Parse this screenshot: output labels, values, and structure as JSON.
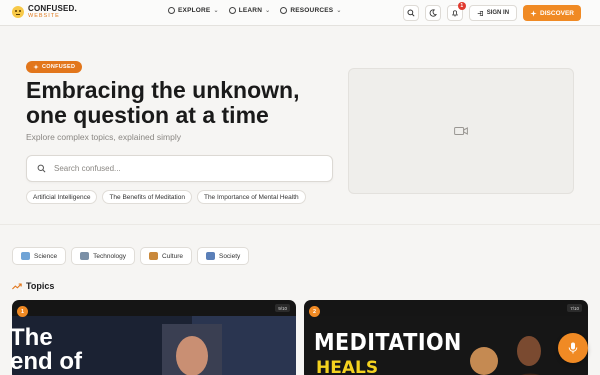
{
  "brand": {
    "name": "CONFUSED.",
    "subtitle": "WEBSITE"
  },
  "nav": {
    "items": [
      {
        "label": "EXPLORE",
        "icon": "compass-icon"
      },
      {
        "label": "LEARN",
        "icon": "compass-icon"
      },
      {
        "label": "RESOURCES",
        "icon": "compass-icon"
      }
    ],
    "notifications_count": "1",
    "signin_label": "SIGN IN",
    "discover_label": "DISCOVER"
  },
  "hero": {
    "tag": "CONFUSED",
    "title": "Embracing the unknown, one question at a time",
    "subtitle": "Explore complex topics, explained simply",
    "search_placeholder": "Search confused...",
    "suggestions": [
      "Artificial Intelligence",
      "The Benefits of Meditation",
      "The Importance of Mental Health"
    ]
  },
  "categories": [
    {
      "label": "Science",
      "icon": "lab-icon",
      "color": "#6fa3d6"
    },
    {
      "label": "Technology",
      "icon": "robot-icon",
      "color": "#7a8fa6"
    },
    {
      "label": "Culture",
      "icon": "palette-icon",
      "color": "#c9883a"
    },
    {
      "label": "Society",
      "icon": "people-icon",
      "color": "#5a7fb8"
    }
  ],
  "topics": {
    "heading": "Topics",
    "cards": [
      {
        "number": "1",
        "count": "9/10",
        "title_lines": [
          "The",
          "end of"
        ]
      },
      {
        "number": "2",
        "count": "7/10",
        "title_line1": "MEDITATION",
        "title_line2": "HEALS"
      }
    ]
  },
  "colors": {
    "accent": "#f08a24",
    "tag": "#e2761b",
    "background": "#f6f5f3"
  }
}
